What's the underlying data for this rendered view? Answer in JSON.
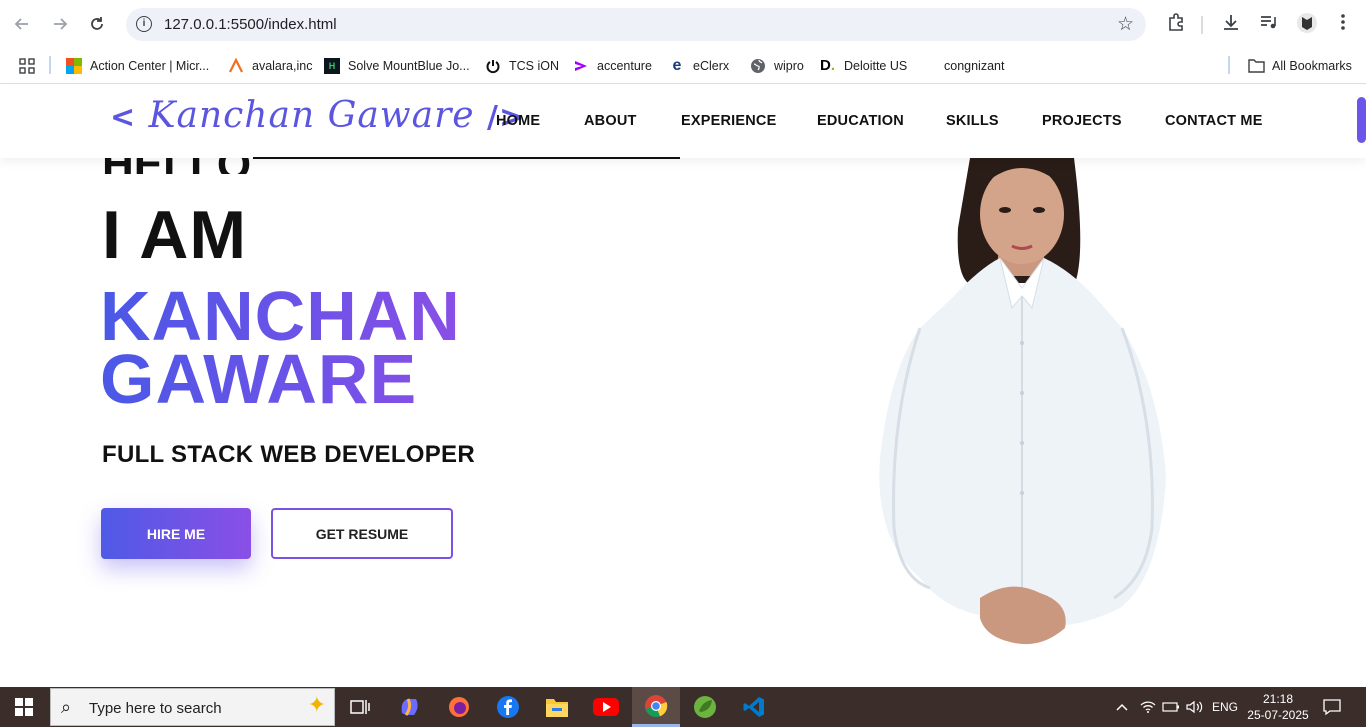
{
  "browser": {
    "url": "127.0.0.1:5500/index.html",
    "bookmarks": [
      {
        "label": "Action Center | Micr...",
        "icon": "microsoft-icon"
      },
      {
        "label": "avalara,inc",
        "icon": "avalara-icon"
      },
      {
        "label": "Solve MountBlue Jo...",
        "icon": "hackerrank-icon"
      },
      {
        "label": "TCS iON",
        "icon": "tcs-icon"
      },
      {
        "label": "accenture",
        "icon": "accenture-icon"
      },
      {
        "label": "eClerx",
        "icon": "eclerx-icon"
      },
      {
        "label": "wipro",
        "icon": "globe-icon"
      },
      {
        "label": "Deloitte US",
        "icon": "deloitte-icon"
      },
      {
        "label": "congnizant",
        "icon": ""
      }
    ],
    "all_bookmarks": "All Bookmarks"
  },
  "site": {
    "logo": {
      "open": "<",
      "name": "Kanchan Gaware",
      "close": "/>"
    },
    "menu": [
      "HOME",
      "ABOUT",
      "EXPERIENCE",
      "EDUCATION",
      "SKILLS",
      "PROJECTS",
      "CONTACT ME"
    ],
    "hero": {
      "hello": "HELLO",
      "iam": "I AM",
      "name_line1": "KANCHAN",
      "name_line2": "GAWARE",
      "role": "FULL STACK WEB DEVELOPER",
      "hire_btn": "HIRE ME",
      "resume_btn": "GET RESUME"
    },
    "colors": {
      "accent": "#5b55e0",
      "accent2": "#8a4fe6"
    }
  },
  "taskbar": {
    "search_placeholder": "Type here to search",
    "lang": "ENG",
    "time": "21:18",
    "date": "25-07-2025"
  }
}
